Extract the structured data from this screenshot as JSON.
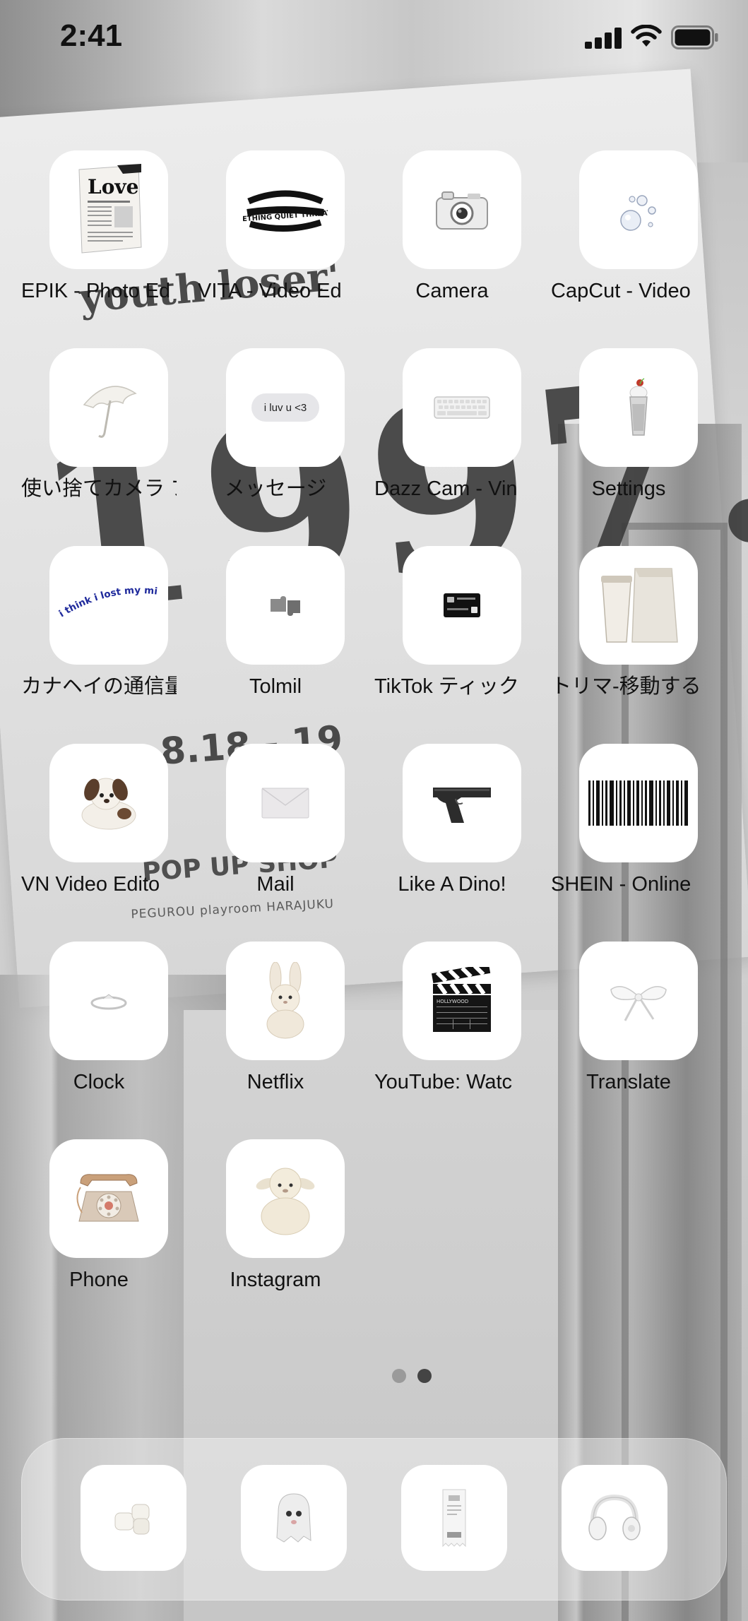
{
  "status_bar": {
    "time": "2:41"
  },
  "wallpaper": {
    "text_line1": "youth loser'",
    "text_big": "1997.",
    "text_date": "8.18 - 19",
    "text_shop": "POP UP SHOP",
    "text_small": "PEGUROU playroom HARAJUKU"
  },
  "apps": [
    {
      "label": "EPIK - Photo Ed",
      "icon": "love-newspaper-icon",
      "icon_text": "Love"
    },
    {
      "label": "VITA - Video Ed",
      "icon": "something-quiet-text-icon",
      "icon_text": "SOMETHING QUIET THREATENS"
    },
    {
      "label": "Camera",
      "icon": "camera-icon"
    },
    {
      "label": "CapCut - Video",
      "icon": "bubbles-icon"
    },
    {
      "label": "使い捨てカメラ フ",
      "icon": "umbrella-icon"
    },
    {
      "label": "メッセージ",
      "icon": "chat-bubble-icon",
      "icon_text": "i luv u <3"
    },
    {
      "label": "Dazz Cam - Vin",
      "icon": "keyboard-icon"
    },
    {
      "label": "Settings",
      "icon": "milkshake-icon"
    },
    {
      "label": "カナヘイの通信量",
      "icon": "lost-my-mind-text-icon",
      "icon_text": "i think i lost my mind a while ago"
    },
    {
      "label": "Tolmil",
      "icon": "puzzle-pieces-icon"
    },
    {
      "label": "TikTok ティック",
      "icon": "credit-card-icon"
    },
    {
      "label": "トリマ-移動する",
      "icon": "coffee-bag-icon"
    },
    {
      "label": "VN Video Edito",
      "icon": "plush-dog-icon"
    },
    {
      "label": "Mail",
      "icon": "envelope-icon"
    },
    {
      "label": "Like A Dino!",
      "icon": "pistol-icon"
    },
    {
      "label": "SHEIN - Online",
      "icon": "barcode-icon"
    },
    {
      "label": "Clock",
      "icon": "ring-icon"
    },
    {
      "label": "Netflix",
      "icon": "plush-bunny-icon"
    },
    {
      "label": "YouTube: Watc",
      "icon": "clapperboard-icon",
      "icon_text": "HOLLYWOOD"
    },
    {
      "label": "Translate",
      "icon": "ribbon-bow-icon"
    },
    {
      "label": "Phone",
      "icon": "rotary-phone-icon"
    },
    {
      "label": "Instagram",
      "icon": "plush-lamb-icon"
    }
  ],
  "page_indicator": {
    "pages": 2,
    "current": 2
  },
  "dock": [
    {
      "icon": "marshmallows-icon"
    },
    {
      "icon": "ghost-icon"
    },
    {
      "icon": "receipt-icon"
    },
    {
      "icon": "headphones-icon"
    }
  ],
  "colors": {
    "tile": "#ffffff",
    "label": "#111111",
    "dot_active": "#444444",
    "dot_inactive": "#9a9a9a"
  }
}
